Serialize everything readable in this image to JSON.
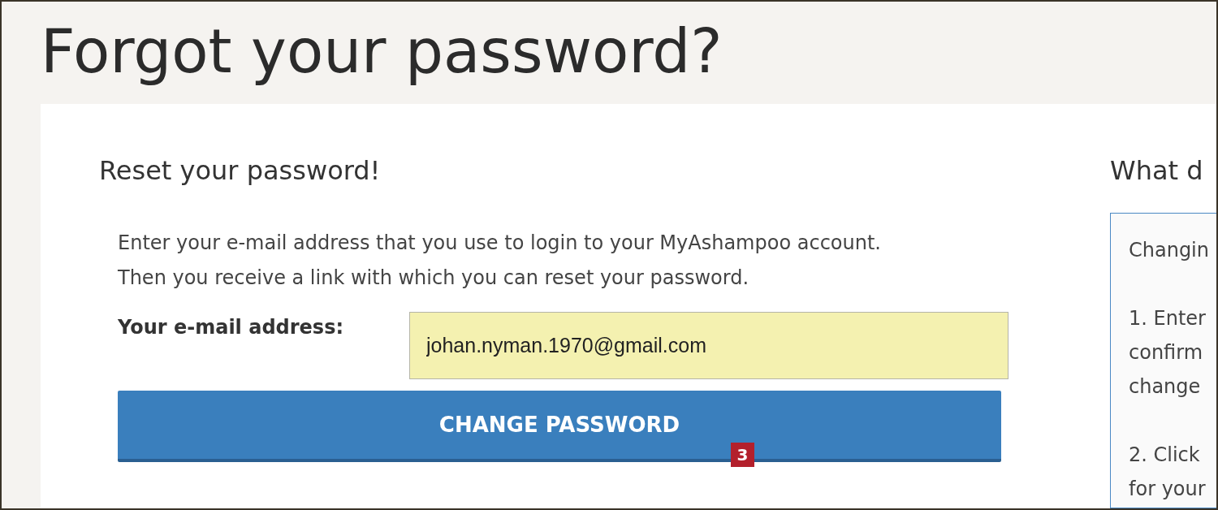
{
  "page_title": "Forgot your password?",
  "reset_form": {
    "heading": "Reset your password!",
    "instructions": [
      "Enter your e-mail address that you use to login to your MyAshampoo account.",
      "Then you receive a link with which you can reset your password."
    ],
    "email_label": "Your e-mail address:",
    "email_value": "johan.nyman.1970@gmail.com",
    "submit_button": "CHANGE PASSWORD",
    "callout_badge": "3"
  },
  "help_panel": {
    "heading": "What d",
    "paragraphs": [
      [
        "Changin"
      ],
      [
        "1. Enter",
        "confirm",
        "change"
      ],
      [
        "2. Click",
        "for your"
      ]
    ]
  }
}
